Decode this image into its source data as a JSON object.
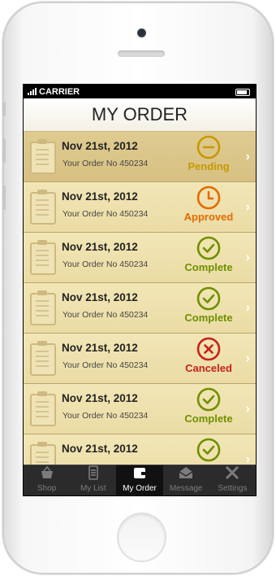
{
  "status_bar": {
    "carrier": "CARRIER"
  },
  "header": {
    "title": "MY ORDER"
  },
  "colors": {
    "pending": "#c79a00",
    "approved": "#e66a00",
    "complete": "#6f8f00",
    "canceled": "#c8211b",
    "row_bg": "#ecdda6",
    "row_selected": "#dcc88d"
  },
  "orders": [
    {
      "date": "Nov 21st, 2012",
      "order_no": "Your Order No 450234",
      "status": "Pending",
      "icon": "minus-circle-icon",
      "status_key": "pending",
      "selected": true
    },
    {
      "date": "Nov 21st, 2012",
      "order_no": "Your Order No 450234",
      "status": "Approved",
      "icon": "clock-icon",
      "status_key": "approved"
    },
    {
      "date": "Nov 21st, 2012",
      "order_no": "Your Order No 450234",
      "status": "Complete",
      "icon": "check-circle-icon",
      "status_key": "complete"
    },
    {
      "date": "Nov 21st, 2012",
      "order_no": "Your Order No 450234",
      "status": "Complete",
      "icon": "check-circle-icon",
      "status_key": "complete"
    },
    {
      "date": "Nov 21st, 2012",
      "order_no": "Your Order No 450234",
      "status": "Canceled",
      "icon": "x-circle-icon",
      "status_key": "canceled"
    },
    {
      "date": "Nov 21st, 2012",
      "order_no": "Your Order No 450234",
      "status": "Complete",
      "icon": "check-circle-icon",
      "status_key": "complete"
    },
    {
      "date": "Nov 21st, 2012",
      "order_no": "",
      "status": "",
      "icon": "check-circle-icon",
      "status_key": "complete"
    }
  ],
  "tabs": [
    {
      "label": "Shop",
      "icon": "basket-icon"
    },
    {
      "label": "My List",
      "icon": "document-icon"
    },
    {
      "label": "My Order",
      "icon": "wallet-icon",
      "active": true
    },
    {
      "label": "Message",
      "icon": "envelope-icon"
    },
    {
      "label": "Settings",
      "icon": "tools-icon"
    }
  ]
}
